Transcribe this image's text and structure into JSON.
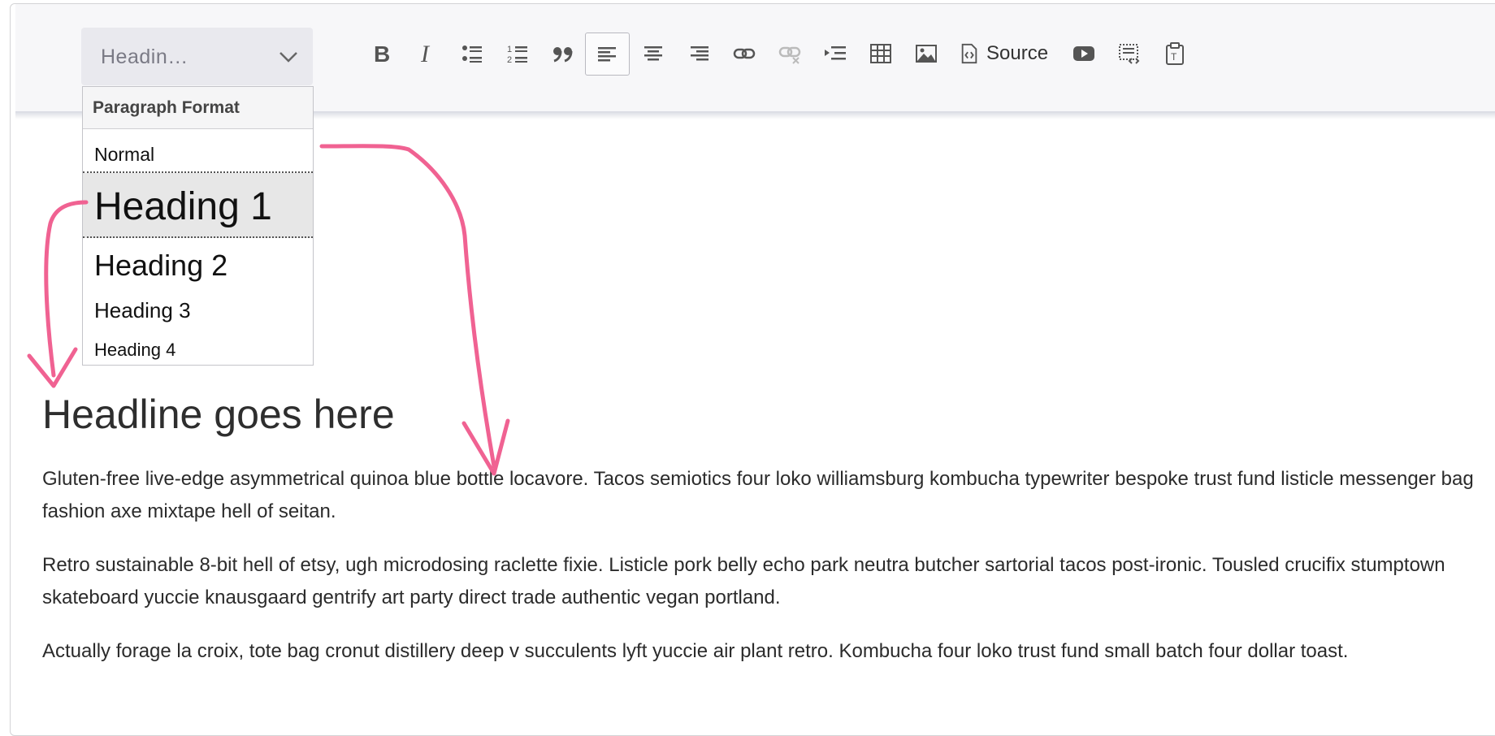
{
  "toolbar": {
    "format_select_value": "Headin…",
    "source_label": "Source",
    "buttons": [
      "bold",
      "italic",
      "bulleted-list",
      "numbered-list",
      "blockquote",
      "align-left",
      "align-center",
      "align-right",
      "link",
      "unlink",
      "indent",
      "table",
      "image",
      "source",
      "youtube",
      "templates",
      "paste-text"
    ]
  },
  "dropdown": {
    "header": "Paragraph Format",
    "items": [
      "Normal",
      "Heading 1",
      "Heading 2",
      "Heading 3",
      "Heading 4"
    ],
    "selected": "Heading 1"
  },
  "content": {
    "headline": "Headline goes here",
    "paragraphs": [
      "Gluten-free live-edge asymmetrical quinoa blue bottle locavore. Tacos semiotics four loko williamsburg kombucha typewriter bespoke trust fund listicle messenger bag fashion axe mixtape hell of seitan.",
      "Retro sustainable 8-bit hell of etsy, ugh microdosing raclette fixie. Listicle pork belly echo park neutra butcher sartorial tacos post-ironic. Tousled crucifix stumptown skateboard yuccie knausgaard gentrify art party direct trade authentic vegan portland.",
      "Actually forage la croix, tote bag cronut distillery deep v succulents lyft yuccie air plant retro. Kombucha four loko trust fund small batch four dollar toast."
    ]
  },
  "colors": {
    "annotation": "#f06292",
    "active_border": "#b9b9c0"
  }
}
